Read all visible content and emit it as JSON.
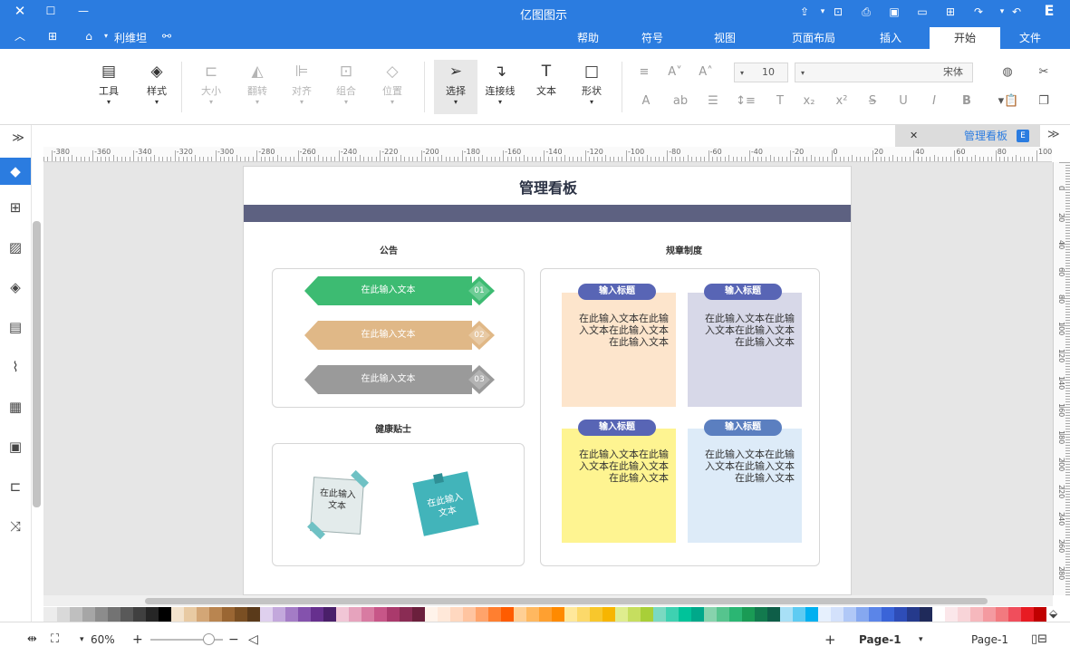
{
  "titlebar": {
    "app_title": "亿图图示",
    "icons": [
      "close-icon",
      "maximize-icon",
      "minimize-icon"
    ],
    "quick_actions": [
      "share-icon",
      "undo-icon",
      "redo-icon",
      "new-icon",
      "open-icon",
      "save-icon",
      "print-icon",
      "export-icon",
      "more-icon"
    ]
  },
  "menu_tabs": [
    "文件",
    "开始",
    "插入",
    "页面布局",
    "视图",
    "符号",
    "帮助"
  ],
  "account": {
    "label": "利维坦"
  },
  "ribbon": {
    "tools": [
      {
        "label": "形状",
        "icon": "rectangle-icon"
      },
      {
        "label": "文本",
        "icon": "text-icon"
      },
      {
        "label": "连接线",
        "icon": "connector-icon"
      },
      {
        "label": "选择",
        "icon": "select-icon"
      },
      {
        "label": "位置",
        "icon": "position-icon"
      },
      {
        "label": "组合",
        "icon": "group-icon"
      },
      {
        "label": "对齐",
        "icon": "align-icon"
      },
      {
        "label": "翻转",
        "icon": "flip-icon"
      },
      {
        "label": "大小",
        "icon": "size-icon"
      },
      {
        "label": "样式",
        "icon": "style-icon"
      },
      {
        "label": "工具",
        "icon": "tools-icon"
      }
    ],
    "font_name": "宋体",
    "font_size": "10"
  },
  "doc_tab": {
    "label": "管理看板"
  },
  "ruler": {
    "h_labels": [
      "100",
      "80",
      "60",
      "40",
      "20",
      "0",
      "-20",
      "-40",
      "-60",
      "-80",
      "-100",
      "-120",
      "-140",
      "-160",
      "-180",
      "-200",
      "-220",
      "-240",
      "-260",
      "-280",
      "-300",
      "-320",
      "-340",
      "-360",
      "-380"
    ],
    "v_labels": [
      "0",
      "20",
      "40",
      "60",
      "80",
      "100",
      "120",
      "140",
      "160",
      "180",
      "200",
      "220",
      "240",
      "260",
      "280"
    ]
  },
  "document": {
    "title": "管理看板",
    "notice": {
      "heading": "公告",
      "items": [
        {
          "num": "01",
          "text": "在此输入文本",
          "color": "#3dbb72"
        },
        {
          "num": "02",
          "text": "在此输入文本",
          "color": "#e0b887"
        },
        {
          "num": "03",
          "text": "在此输入文本",
          "color": "#9a9a9a"
        }
      ]
    },
    "health": {
      "heading": "健康贴士",
      "notes": [
        {
          "text": "在此输入文本",
          "color": "#42b4ba"
        },
        {
          "text": "在此输入文本",
          "color": "#e3ebeb"
        }
      ]
    },
    "rules": {
      "heading": "规章制度",
      "cards": [
        {
          "title": "输入标题",
          "body": "在此输入文本在此输入文本在此输入文本在此输入文本",
          "bg": "#d7d8e8",
          "head": "#5865b5"
        },
        {
          "title": "输入标题",
          "body": "在此输入文本在此输入文本在此输入文本在此输入文本",
          "bg": "#fde5cc",
          "head": "#5865b5"
        },
        {
          "title": "输入标题",
          "body": "在此输入文本在此输入文本在此输入文本在此输入文本",
          "bg": "#ddebf8",
          "head": "#5b7fc0"
        },
        {
          "title": "输入标题",
          "body": "在此输入文本在此输入文本在此输入文本在此输入文本",
          "bg": "#fef491",
          "head": "#5865b5"
        }
      ]
    }
  },
  "palette": [
    "#c00000",
    "#e81b23",
    "#f04e5c",
    "#f27a7f",
    "#f49aa0",
    "#f6b8bd",
    "#f8d4d8",
    "#fbe7ea",
    "#fff",
    "#1f2a5a",
    "#253a8c",
    "#2e4db8",
    "#3a64d8",
    "#5b85e8",
    "#86a8f0",
    "#b0c8f7",
    "#d3e1fb",
    "#e6f0fd",
    "#00b0f0",
    "#5ecbf2",
    "#a8e0f6",
    "#0e5e48",
    "#127a4e",
    "#1a9b55",
    "#2bb673",
    "#56c48e",
    "#87d3ad",
    "#00a88a",
    "#00c39a",
    "#3ed1b1",
    "#7ad9c1",
    "#a8cf38",
    "#c6de5f",
    "#dfed8e",
    "#f7b500",
    "#f8c72c",
    "#fcd96a",
    "#ffe89b",
    "#ff8a00",
    "#ffa030",
    "#ffb860",
    "#ffcf94",
    "#ff5c00",
    "#ff7f30",
    "#ffa36b",
    "#ffc4a0",
    "#ffd8c0",
    "#ffe8d9",
    "#fff3ea",
    "#6b1f3c",
    "#8a2c54",
    "#aa3a6c",
    "#c75688",
    "#d87ba2",
    "#e6a3bd",
    "#f1c6d6",
    "#4a1f6a",
    "#66308e",
    "#8452ad",
    "#a47cc6",
    "#c3a8dc",
    "#dfd0ee",
    "#5a3a1a",
    "#7a4f23",
    "#9a6633",
    "#b98550",
    "#d3a676",
    "#e8caa3",
    "#f3e3cd",
    "#000000",
    "#262626",
    "#404040",
    "#595959",
    "#737373",
    "#8c8c8c",
    "#a6a6a6",
    "#bfbfbf",
    "#d9d9d9",
    "#ececec"
  ],
  "status": {
    "page_current": "Page-1",
    "page_tab": "Page-1",
    "zoom": "60%"
  }
}
